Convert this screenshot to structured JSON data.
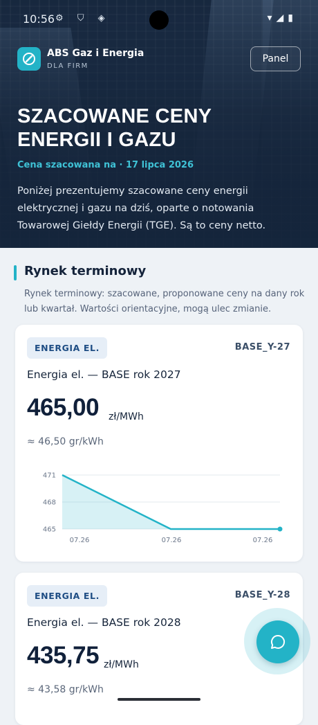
{
  "status_bar": {
    "time": "10:56",
    "icons": "⚙ ⛉ ◈",
    "right": "▾◢▮"
  },
  "brand": {
    "name": "ABS Gaz i Energia",
    "subtitle": "DLA FIRM"
  },
  "header": {
    "panel_button": "Panel"
  },
  "hero": {
    "title": "SZACOWANE CENY ENERGII I GAZU",
    "date_line": "Cena szacowana na · 17 lipca 2026",
    "description": "Poniżej prezentujemy szacowane ceny energii elektrycznej i gazu na dziś, oparte o notowania Towarowej Giełdy Energii (TGE). Są to ceny netto."
  },
  "section": {
    "title": "Rynek terminowy",
    "description": "Rynek terminowy: szacowane, proponowane ceny na dany rok lub kwartał. Wartości orientacyjne, mogą ulec zmianie."
  },
  "cards": [
    {
      "badge": "ENERGIA EL.",
      "code": "BASE_Y-27",
      "title": "Energia el. — BASE rok 2027",
      "price": "465,00",
      "unit": "zł/MWh",
      "sub": "≈ 46,50 gr/kWh",
      "chart": {
        "y_ticks": [
          "471",
          "468",
          "465"
        ],
        "x_ticks": [
          "07.26",
          "07.26",
          "07.26"
        ],
        "ylim": [
          465,
          471
        ],
        "values": [
          471,
          465,
          465,
          465
        ]
      }
    },
    {
      "badge": "ENERGIA EL.",
      "code": "BASE_Y-28",
      "title": "Energia el. — BASE rok 2028",
      "price": "435,75",
      "unit": "zł/MWh",
      "sub": "≈ 43,58 gr/kWh"
    }
  ],
  "colors": {
    "accent": "#23b3c7",
    "hero_bg": "#1b2f4b",
    "title_text": "#10203a"
  }
}
